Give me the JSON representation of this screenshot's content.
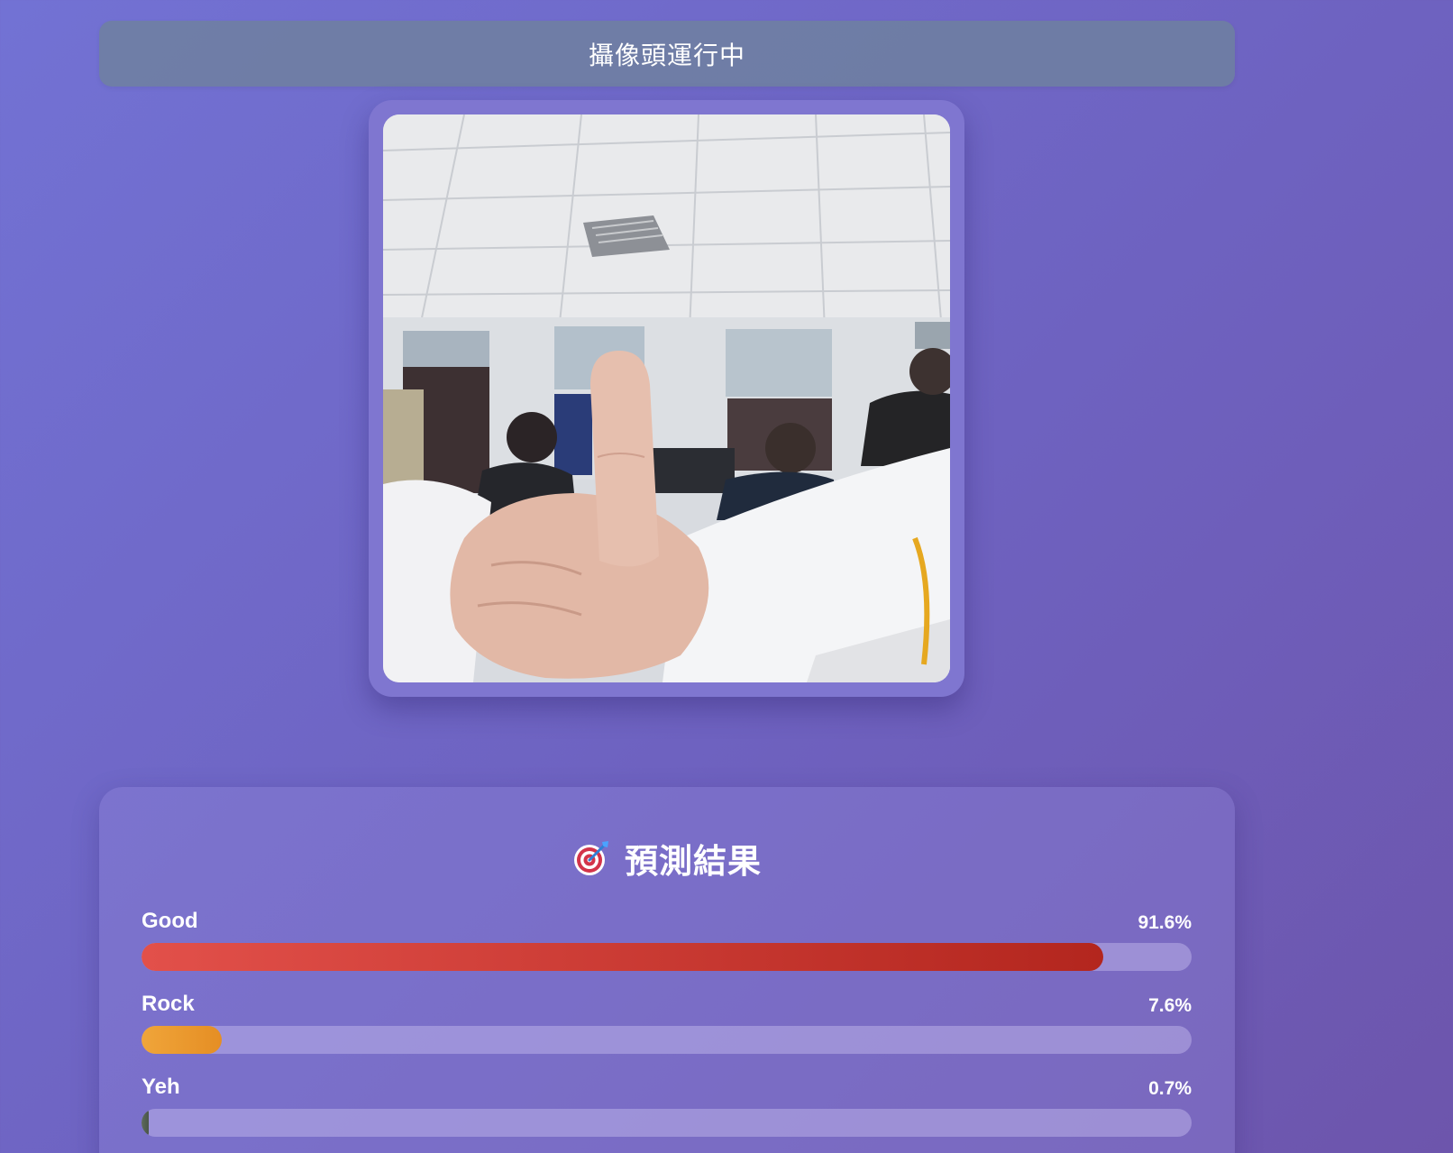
{
  "status": {
    "text": "攝像頭運行中"
  },
  "camera": {
    "icon": "camera-feed"
  },
  "results": {
    "icon": "target-icon",
    "title": "預測結果",
    "predictions": [
      {
        "label": "Good",
        "value_text": "91.6%",
        "value": 0.916,
        "color_start": "#e2504a",
        "color_end": "#b3261e"
      },
      {
        "label": "Rock",
        "value_text": "7.6%",
        "value": 0.076,
        "color_start": "#f0a53a",
        "color_end": "#e58e24"
      },
      {
        "label": "Yeh",
        "value_text": "0.7%",
        "value": 0.007,
        "color_start": "#5d6a5c",
        "color_end": "#4a5548"
      }
    ]
  },
  "colors": {
    "background_start": "#7272d4",
    "background_end": "#6d55ac",
    "status_bar": "#6e80a0",
    "frame": "#7f76d0"
  }
}
